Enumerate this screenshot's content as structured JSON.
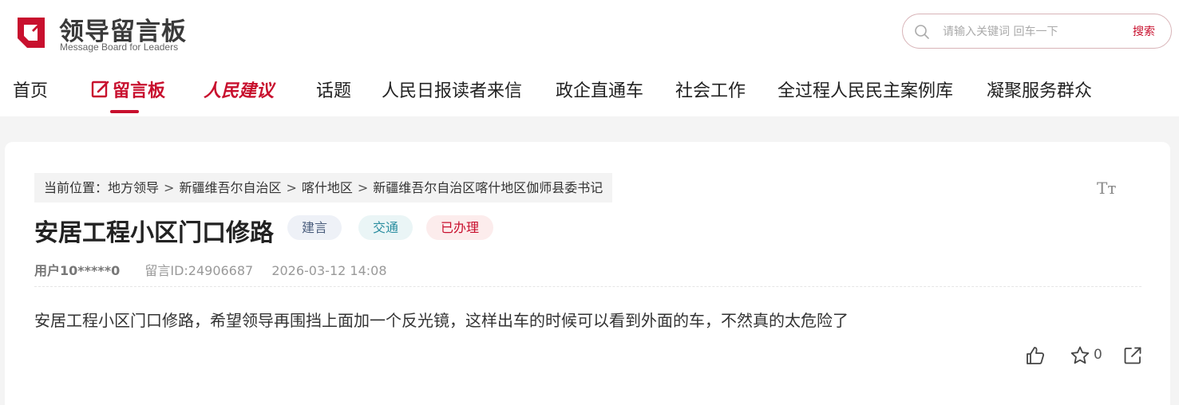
{
  "brand": {
    "title": "领导留言板",
    "subtitle": "Message Board for Leaders",
    "color": "#c8102e"
  },
  "search": {
    "placeholder": "请输入关键词 回车一下",
    "button_label": "搜索"
  },
  "nav": {
    "items": [
      {
        "label": "首页"
      },
      {
        "label": "留言板",
        "active": true
      },
      {
        "label": "人民建议"
      },
      {
        "label": "话题"
      },
      {
        "label": "人民日报读者来信"
      },
      {
        "label": "政企直通车"
      },
      {
        "label": "社会工作"
      },
      {
        "label": "全过程人民民主案例库"
      },
      {
        "label": "凝聚服务群众"
      }
    ]
  },
  "breadcrumb": {
    "prefix": "当前位置：",
    "items": [
      "地方领导",
      "新疆维吾尔自治区",
      "喀什地区",
      "新疆维吾尔自治区喀什地区伽师县委书记"
    ],
    "separator": ">"
  },
  "font_size_toggle": "Tт",
  "message": {
    "title": "安居工程小区门口修路",
    "tags": [
      "建言",
      "交通",
      "已办理"
    ],
    "user": "用户10*****0",
    "id_label": "留言ID:24906687",
    "datetime": "2026-03-12 14:08",
    "content": "安居工程小区门口修路，希望领导再围挡上面加一个反光镜，这样出车的时候可以看到外面的车，不然真的太危险了",
    "favorite_count": "0"
  },
  "icons": {
    "search": "search-icon",
    "like": "thumbs-up-icon",
    "favorite": "star-icon",
    "share": "share-icon",
    "board": "edit-note-icon"
  }
}
